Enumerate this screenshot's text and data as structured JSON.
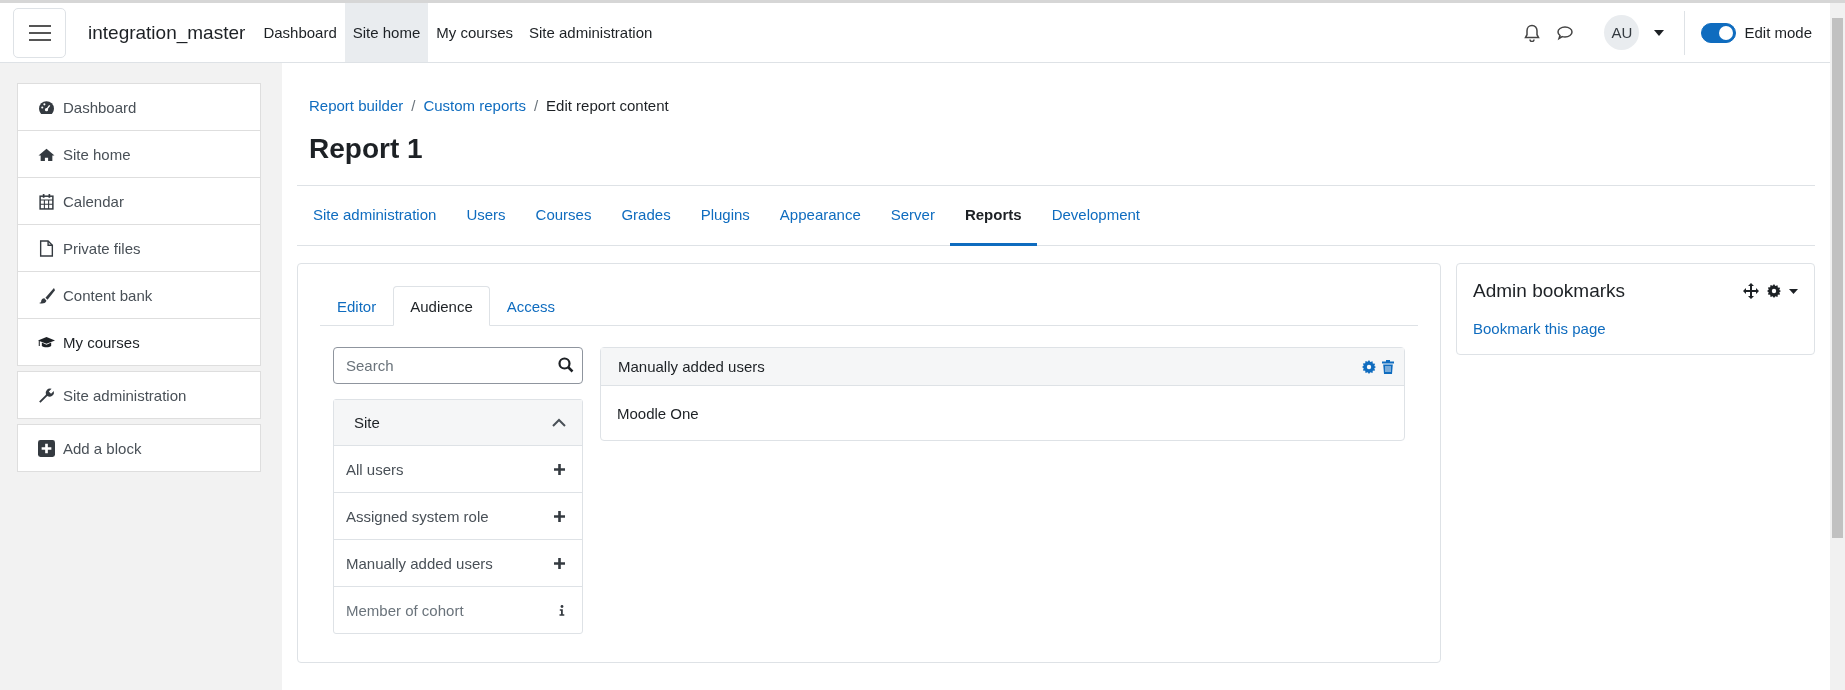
{
  "navbar": {
    "site_name": "integration_master",
    "links": [
      {
        "label": "Dashboard",
        "selected": false
      },
      {
        "label": "Site home",
        "selected": true
      },
      {
        "label": "My courses",
        "selected": false
      },
      {
        "label": "Site administration",
        "selected": false
      }
    ],
    "avatar": "AU",
    "edit_mode": {
      "label": "Edit mode",
      "on": true
    }
  },
  "sidebar": {
    "groups": [
      [
        {
          "label": "Dashboard",
          "kind": "dashboard"
        },
        {
          "label": "Site home",
          "kind": "home"
        },
        {
          "label": "Calendar",
          "kind": "calendar"
        },
        {
          "label": "Private files",
          "kind": "file"
        },
        {
          "label": "Content bank",
          "kind": "brush"
        },
        {
          "label": "My courses",
          "kind": "cap"
        }
      ],
      [
        {
          "label": "Site administration",
          "kind": "wrench"
        }
      ],
      [
        {
          "label": "Add a block",
          "kind": "plus"
        }
      ]
    ]
  },
  "breadcrumb": [
    {
      "label": "Report builder",
      "link": true
    },
    {
      "label": "Custom reports",
      "link": true,
      "separator": "/"
    },
    {
      "label": "Edit report content",
      "link": false,
      "separator": "/"
    }
  ],
  "title": "Report 1",
  "admin_tabs": [
    {
      "label": "Site administration",
      "selected": false
    },
    {
      "label": "Users",
      "selected": false
    },
    {
      "label": "Courses",
      "selected": false
    },
    {
      "label": "Grades",
      "selected": false
    },
    {
      "label": "Plugins",
      "selected": false
    },
    {
      "label": "Appearance",
      "selected": false
    },
    {
      "label": "Server",
      "selected": false
    },
    {
      "label": "Reports",
      "selected": true
    },
    {
      "label": "Development",
      "selected": false
    }
  ],
  "report_tabs": [
    {
      "label": "Editor",
      "selected": false
    },
    {
      "label": "Audience",
      "selected": true
    },
    {
      "label": "Access",
      "selected": false
    }
  ],
  "search": {
    "placeholder": "Search"
  },
  "category": {
    "title": "Site",
    "expanded": true,
    "items": [
      {
        "label": "All users",
        "disabled": false
      },
      {
        "label": "Assigned system role",
        "disabled": false
      },
      {
        "label": "Manually added users",
        "disabled": false
      },
      {
        "label": "Member of cohort",
        "disabled": true
      }
    ]
  },
  "audience_cards": [
    {
      "title": "Manually added users",
      "body": "Moodle One"
    }
  ],
  "block": {
    "title": "Admin bookmarks",
    "link": "Bookmark this page"
  }
}
